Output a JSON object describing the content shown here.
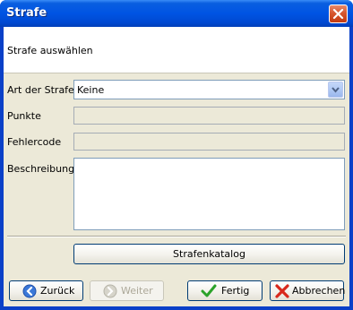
{
  "window": {
    "title": "Strafe"
  },
  "header": {
    "text": "Strafe auswählen"
  },
  "form": {
    "art_label": "Art der Strafe",
    "art_value": "Keine",
    "punkte_label": "Punkte",
    "punkte_value": "",
    "fehlercode_label": "Fehlercode",
    "fehlercode_value": "",
    "beschreibung_label": "Beschreibung",
    "beschreibung_value": "",
    "katalog_button": "Strafenkatalog"
  },
  "footer": {
    "back_label": "Zurück",
    "next_label": "Weiter",
    "finish_label": "Fertig",
    "cancel_label": "Abbrechen"
  },
  "icons": {
    "close": "close-icon",
    "back": "arrow-left-circle-icon",
    "next": "arrow-right-circle-icon",
    "finish": "checkmark-icon",
    "cancel": "red-x-icon",
    "dropdown": "chevron-down-icon"
  },
  "colors": {
    "titlebar": "#0054e3",
    "dialog_bg": "#ece9d8",
    "checkmark": "#2aa22a",
    "cancel_x": "#d8281c"
  }
}
